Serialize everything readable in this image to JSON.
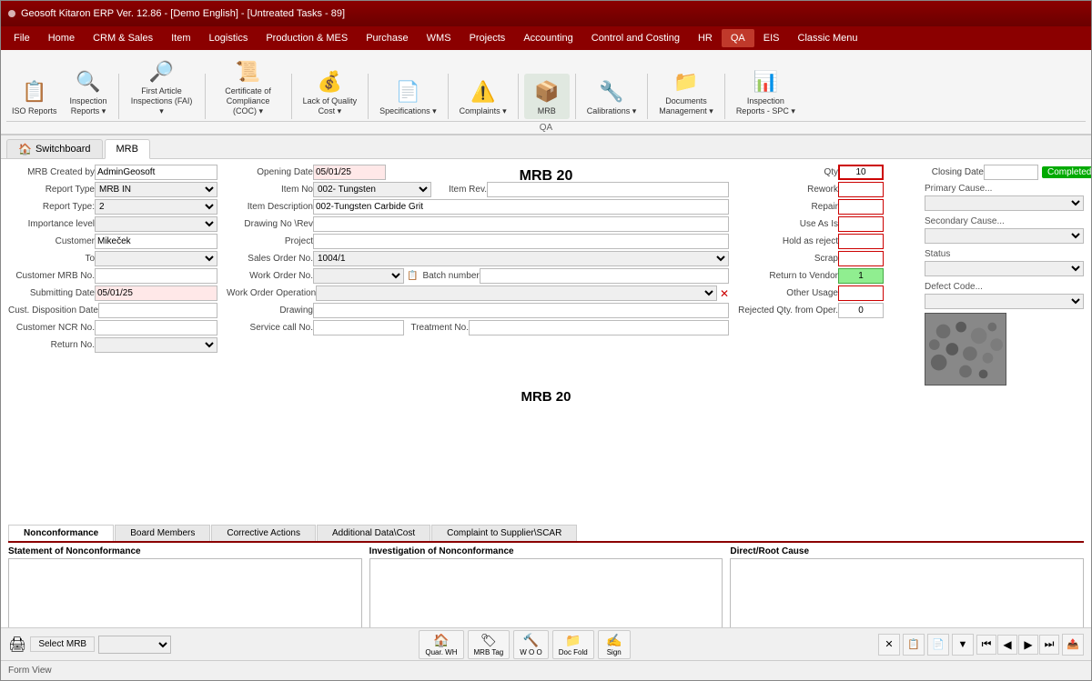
{
  "window": {
    "title": "Geosoft Kitaron ERP Ver. 12.86 - [Demo English] - [Untreated Tasks - 89]",
    "status": "Form View"
  },
  "menubar": {
    "items": [
      "File",
      "Home",
      "CRM & Sales",
      "Item",
      "Logistics",
      "Production & MES",
      "Purchase",
      "WMS",
      "Projects",
      "Accounting",
      "Control and Costing",
      "HR",
      "QA",
      "EIS",
      "Classic Menu"
    ],
    "active": "QA"
  },
  "ribbon": {
    "section": "QA",
    "buttons": [
      {
        "id": "iso",
        "label": "ISO\nReports",
        "icon": "📋"
      },
      {
        "id": "inspection",
        "label": "Inspection\nReports",
        "icon": "🔍"
      },
      {
        "id": "fai",
        "label": "First Article\nInspections (FAI)",
        "icon": "🔎"
      },
      {
        "id": "coc",
        "label": "Certificate of\nCompliance (COC)",
        "icon": "📜"
      },
      {
        "id": "loq",
        "label": "Lack of Quality\nCost",
        "icon": "💰"
      },
      {
        "id": "specs",
        "label": "Specifications",
        "icon": "📄"
      },
      {
        "id": "complaints",
        "label": "Complaints",
        "icon": "⚠️"
      },
      {
        "id": "mrb",
        "label": "MRB",
        "icon": "📦"
      },
      {
        "id": "calibrations",
        "label": "Calibrations",
        "icon": "🔧"
      },
      {
        "id": "documents",
        "label": "Documents\nManagement",
        "icon": "📁"
      },
      {
        "id": "inspection_spc",
        "label": "Inspection\nReports - SPC",
        "icon": "📊"
      }
    ]
  },
  "tabs": {
    "items": [
      {
        "id": "switchboard",
        "label": "Switchboard",
        "icon": "🏠"
      },
      {
        "id": "mrb",
        "label": "MRB",
        "active": true
      }
    ]
  },
  "form": {
    "title": "MRB 20",
    "mrb_created_by_label": "MRB Created by",
    "mrb_created_by": "AdminGeosoft",
    "report_type_label": "Report Type",
    "report_type": "MRB IN",
    "report_type2_label": "Report Type:",
    "report_type2": "2",
    "importance_level_label": "Importance level",
    "importance_level": "",
    "customer_label": "Customer",
    "customer": "Mikeček",
    "to_label": "To",
    "to": "",
    "customer_mrb_label": "Customer MRB No.",
    "customer_mrb": "",
    "submitting_date_label": "Submitting Date",
    "submitting_date": "05/01/25",
    "cust_disposition_label": "Cust. Disposition Date",
    "cust_disposition": "",
    "customer_ncr_label": "Customer NCR No.",
    "customer_ncr": "",
    "return_no_label": "Return No.",
    "return_no": "",
    "opening_date_label": "Opening Date",
    "opening_date": "05/01/25",
    "item_no_label": "Item No",
    "item_no": "002- Tungsten",
    "item_rev_label": "Item Rev.",
    "item_rev": "",
    "item_desc_label": "Item Description",
    "item_desc": "002-Tungsten Carbide Grit",
    "drawing_no_label": "Drawing No \\Rev",
    "drawing_no": "",
    "project_label": "Project",
    "project": "",
    "sales_order_label": "Sales Order No.",
    "sales_order": "1004/1",
    "work_order_label": "Work Order No.",
    "work_order": "",
    "batch_label": "Batch number",
    "batch": "",
    "work_order_op_label": "Work Order Operation",
    "work_order_op": "",
    "drawing_label": "Drawing",
    "drawing": "",
    "service_call_label": "Service call No.",
    "service_call": "",
    "treatment_label": "Treatment No.",
    "treatment": "",
    "closing_date_label": "Closing Date",
    "closing_date": "",
    "completed_label": "Completed",
    "primary_cause_label": "Primary\nCause...",
    "primary_cause": "",
    "secondary_cause_label": "Secondary\nCause...",
    "secondary_cause": "",
    "status_label": "Status",
    "status": "",
    "defect_code_label": "Defect Code...",
    "defect_code": "",
    "qty_label": "Qty",
    "qty": "10",
    "rework_label": "Rework",
    "rework": "",
    "repair_label": "Repair",
    "repair": "",
    "use_as_is_label": "Use As Is",
    "use_as_is": "",
    "hold_as_reject_label": "Hold as reject",
    "hold_as_reject": "",
    "scrap_label": "Scrap",
    "scrap": "",
    "return_to_vendor_label": "Return to Vendor",
    "return_to_vendor": "1",
    "other_usage_label": "Other Usage",
    "other_usage": "",
    "rejected_qty_label": "Rejected Qty. from Oper.",
    "rejected_qty": "0"
  },
  "section_tabs": {
    "items": [
      {
        "id": "nonconformance",
        "label": "Nonconformance",
        "active": true
      },
      {
        "id": "board_members",
        "label": "Board Members"
      },
      {
        "id": "corrective_actions",
        "label": "Corrective Actions"
      },
      {
        "id": "additional_data",
        "label": "Additional Data\\Cost"
      },
      {
        "id": "complaint",
        "label": "Complaint to Supplier\\SCAR"
      }
    ]
  },
  "text_areas": {
    "statement_label": "Statement of Nonconformance",
    "investigation_label": "Investigation of Nonconformance",
    "direct_root_label": "Direct/Root Cause"
  },
  "bottom_toolbar": {
    "print_icon": "🖨",
    "select_mrb_label": "Select MRB",
    "quar_wh_label": "Quar.\nWH",
    "mrb_tag_label": "MRB Tag",
    "wo_o_label": "W O\nO",
    "doc_fold_label": "Doc\nFold",
    "sign_label": "Sign",
    "nav_first": "⏮",
    "nav_prev": "◀",
    "nav_next": "▶",
    "nav_last": "⏭",
    "filter_icon": "▼",
    "delete_icon": "✕",
    "copy_icon": "📋",
    "new_icon": "📄",
    "export_icon": "📤"
  }
}
